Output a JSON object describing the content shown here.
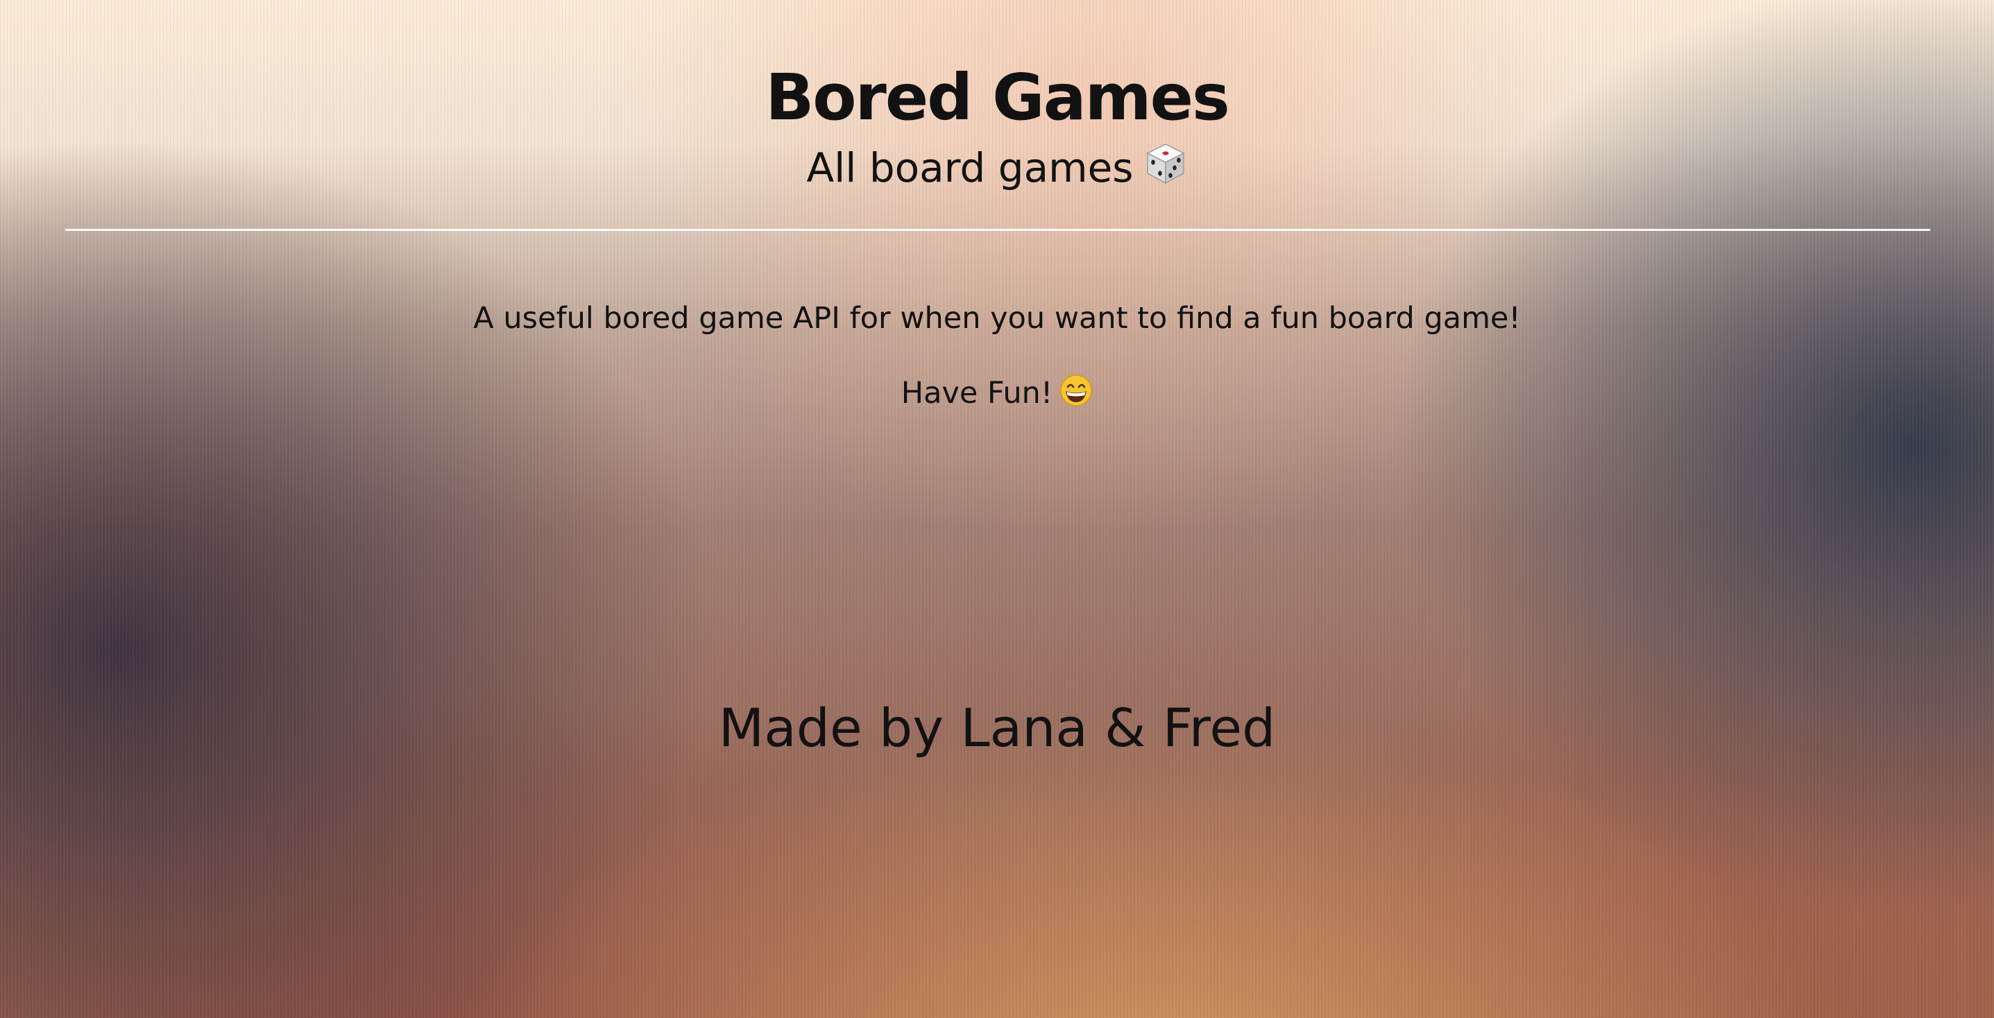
{
  "header": {
    "title": "Bored Games",
    "subtitle": "All board games",
    "subtitle_icon": "game-die-icon"
  },
  "main": {
    "description": "A useful bored game API for when you want to find a fun board game!",
    "tagline": "Have Fun!",
    "tagline_icon": "grinning-face-icon"
  },
  "footer": {
    "credit": "Made by Lana & Fred"
  },
  "colors": {
    "text": "#121212",
    "divider": "#ffffff",
    "background_top": "#fbecd8",
    "background_bottom": "#d6955f"
  }
}
